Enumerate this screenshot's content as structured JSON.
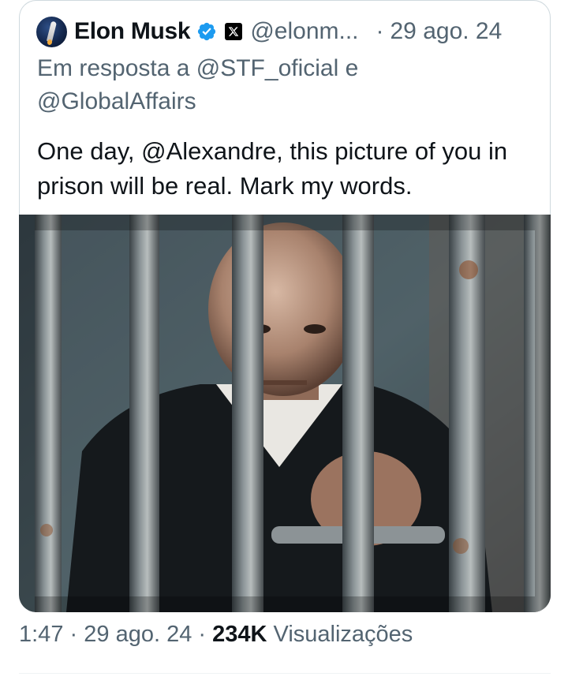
{
  "tweet": {
    "author_name": "Elon Musk",
    "handle": "@elonm...",
    "separator": "·",
    "date": "29 ago. 24",
    "reply_prefix": "Em resposta a",
    "reply_mention_1": "@STF_oficial",
    "reply_conjunction": "e",
    "reply_mention_2": "@GlobalAffairs",
    "text": "One day, @Alexandre, this picture of you in prison will be real. Mark my words."
  },
  "footer": {
    "time": "1:47",
    "sep1": "·",
    "date": "29 ago. 24",
    "sep2": "·",
    "views_count": "234K",
    "views_label": "Visualizações"
  },
  "colors": {
    "verified_badge": "#1d9bf0",
    "secondary_text": "#536471",
    "primary_text": "#0f1419"
  },
  "icons": {
    "verified": "verified-badge-icon",
    "affiliation": "x-logo-icon",
    "avatar": "avatar-icon"
  }
}
